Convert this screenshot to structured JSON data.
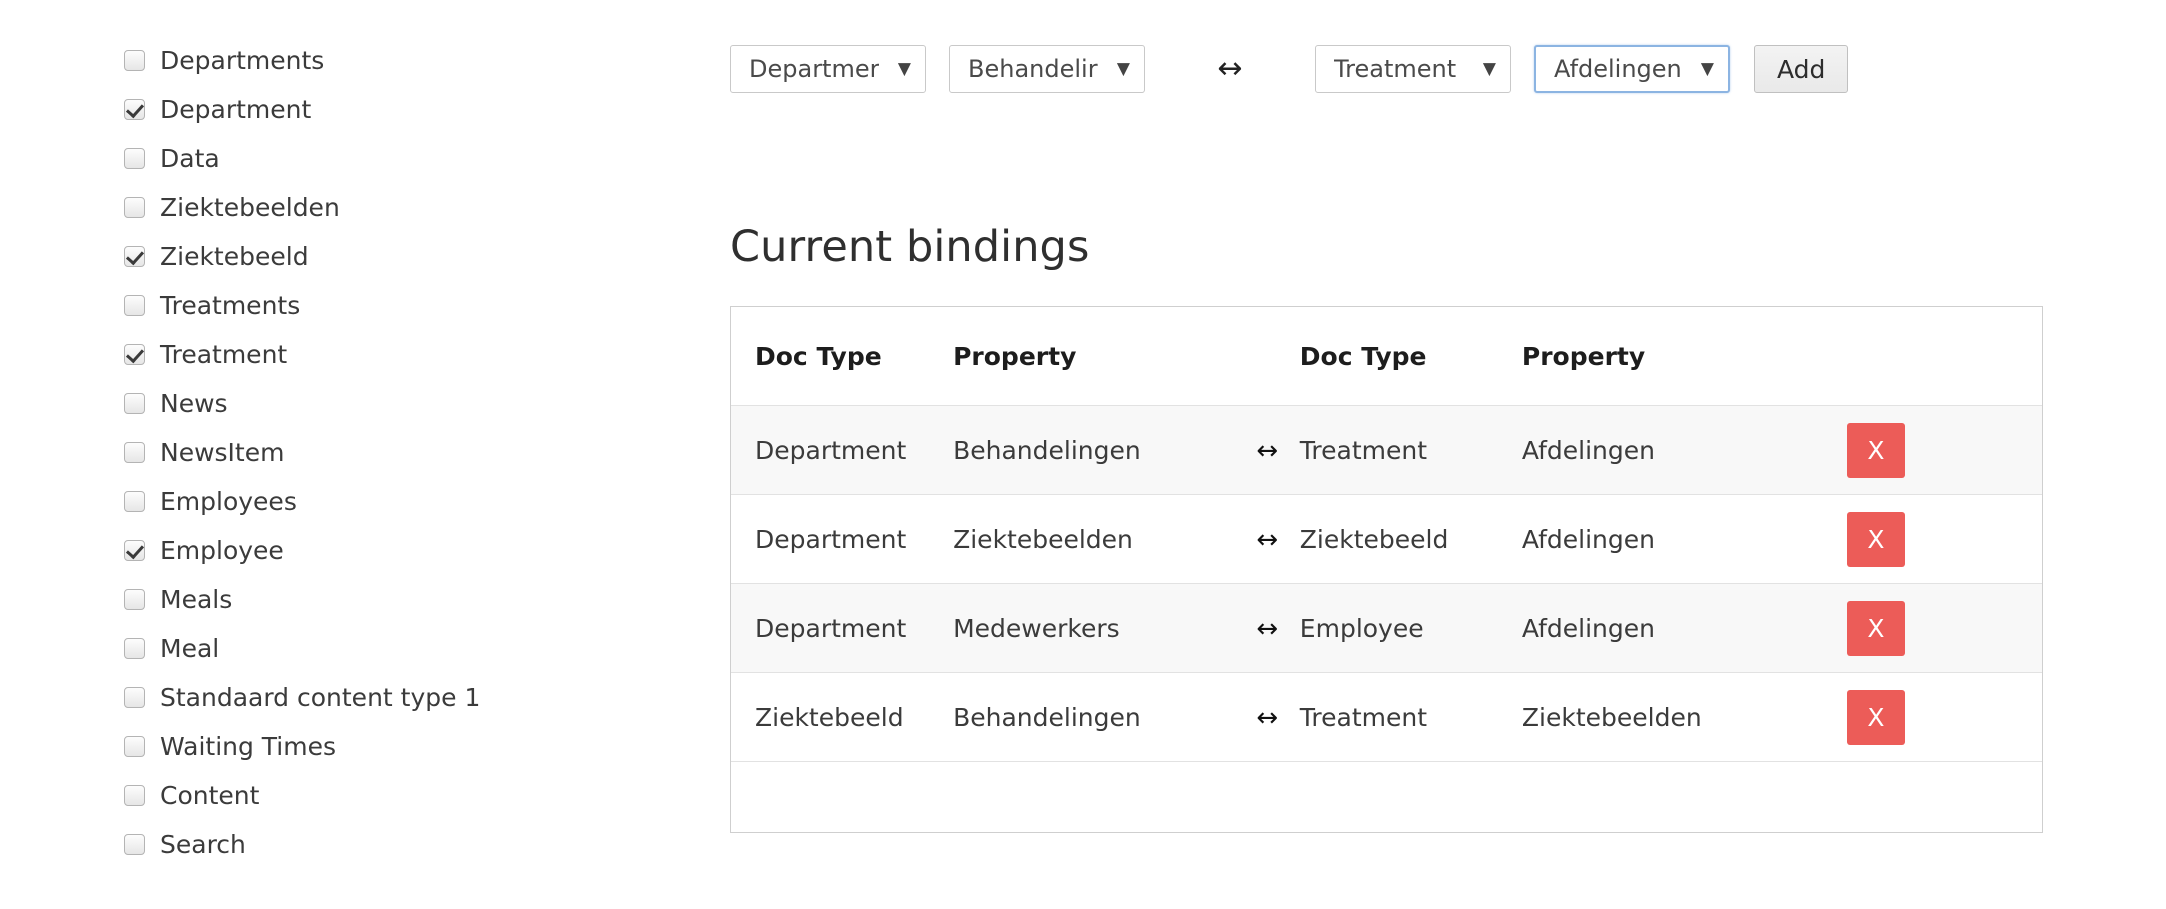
{
  "doctype_list": {
    "items": [
      {
        "label": "Departments",
        "checked": false
      },
      {
        "label": "Department",
        "checked": true
      },
      {
        "label": "Data",
        "checked": false
      },
      {
        "label": "Ziektebeelden",
        "checked": false
      },
      {
        "label": "Ziektebeeld",
        "checked": true
      },
      {
        "label": "Treatments",
        "checked": false
      },
      {
        "label": "Treatment",
        "checked": true
      },
      {
        "label": "News",
        "checked": false
      },
      {
        "label": "NewsItem",
        "checked": false
      },
      {
        "label": "Employees",
        "checked": false
      },
      {
        "label": "Employee",
        "checked": true
      },
      {
        "label": "Meals",
        "checked": false
      },
      {
        "label": "Meal",
        "checked": false
      },
      {
        "label": "Standaard content type 1",
        "checked": false
      },
      {
        "label": "Waiting Times",
        "checked": false
      },
      {
        "label": "Content",
        "checked": false
      },
      {
        "label": "Search",
        "checked": false
      }
    ]
  },
  "toolbar": {
    "left_doctype_value": "Departmer",
    "left_property_value": "Behandelir",
    "arrow_glyph": "↔",
    "right_doctype_value": "Treatment",
    "right_property_value": "Afdelingen",
    "caret_glyph": "▼",
    "add_label": "Add"
  },
  "bindings": {
    "heading": "Current bindings",
    "columns": [
      "Doc Type",
      "Property",
      "Doc Type",
      "Property"
    ],
    "arrow_glyph": "↔",
    "delete_label": "X",
    "rows": [
      {
        "doctype_a": "Department",
        "property_a": "Behandelingen",
        "doctype_b": "Treatment",
        "property_b": "Afdelingen",
        "striped": true
      },
      {
        "doctype_a": "Department",
        "property_a": "Ziektebeelden",
        "doctype_b": "Ziektebeeld",
        "property_b": "Afdelingen",
        "striped": false
      },
      {
        "doctype_a": "Department",
        "property_a": "Medewerkers",
        "doctype_b": "Employee",
        "property_b": "Afdelingen",
        "striped": true
      },
      {
        "doctype_a": "Ziektebeeld",
        "property_a": "Behandelingen",
        "doctype_b": "Treatment",
        "property_b": "Ziektebeelden",
        "striped": false
      }
    ]
  },
  "colors": {
    "delete_button": "#ec5c58",
    "focus_border": "#8cb4e2",
    "row_stripe": "#f8f8f8"
  }
}
